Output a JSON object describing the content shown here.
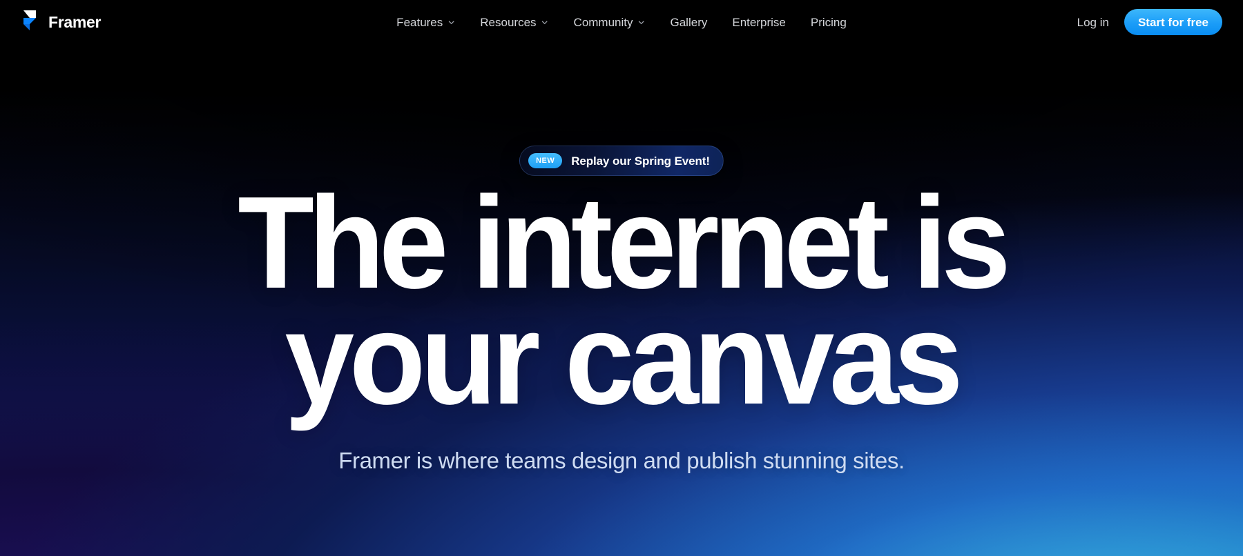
{
  "brand": {
    "name": "Framer",
    "logo_icon": "framer-logo-icon",
    "logo_colors": {
      "top": "#ffffff",
      "bottom": "#0099ff"
    }
  },
  "nav": {
    "items": [
      {
        "label": "Features",
        "has_dropdown": true,
        "icon": "chevron-down-icon"
      },
      {
        "label": "Resources",
        "has_dropdown": true,
        "icon": "chevron-down-icon"
      },
      {
        "label": "Community",
        "has_dropdown": true,
        "icon": "chevron-down-icon"
      },
      {
        "label": "Gallery",
        "has_dropdown": false,
        "icon": ""
      },
      {
        "label": "Enterprise",
        "has_dropdown": false,
        "icon": ""
      },
      {
        "label": "Pricing",
        "has_dropdown": false,
        "icon": ""
      }
    ],
    "login_label": "Log in",
    "cta_label": "Start for free",
    "cta_color": "#1b9df8",
    "link_color": "#d4d6da"
  },
  "announcement": {
    "badge": "NEW",
    "badge_color": "#1fa0f5",
    "text": "Replay our Spring Event!"
  },
  "hero": {
    "headline_line1": "The internet is",
    "headline_line2": "your canvas",
    "subhead": "Framer is where teams design and publish stunning sites.",
    "headline_color": "#ffffff",
    "subhead_color": "#cfdcf2",
    "background_colors": {
      "top": "#000000",
      "bottom_left": "#1b0f56",
      "bottom_right": "#2aa6dc",
      "mid": "#173a8c"
    }
  }
}
